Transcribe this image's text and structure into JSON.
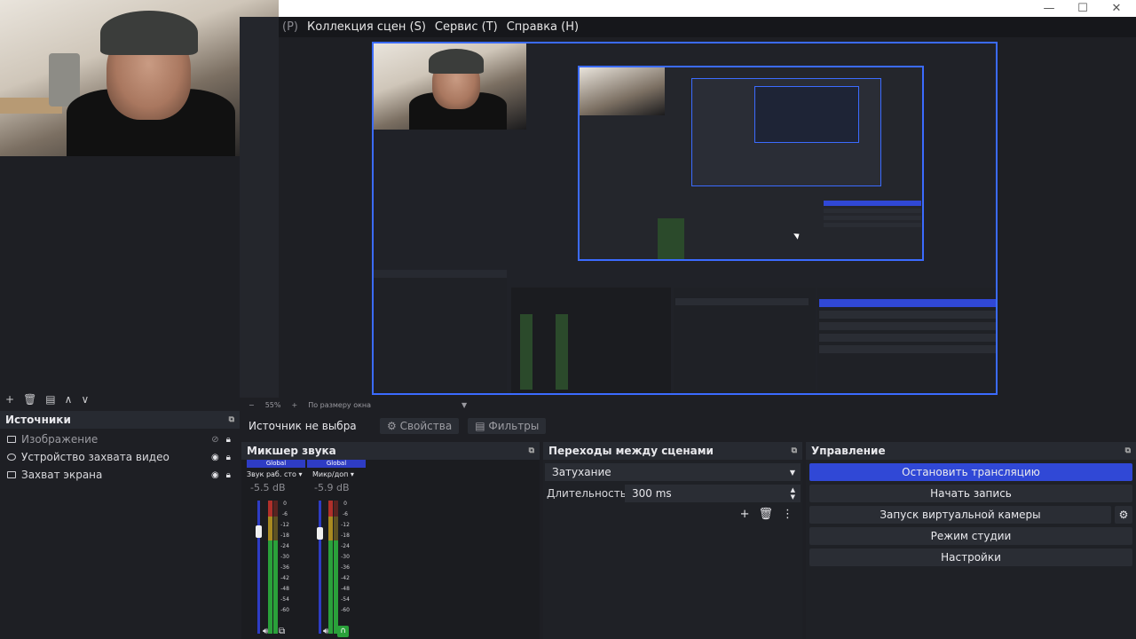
{
  "menu": {
    "prefix": "(P)",
    "items": [
      "Коллекция сцен (S)",
      "Сервис (T)",
      "Справка (H)"
    ]
  },
  "window_controls": {
    "minimize": "—",
    "maximize": "☐",
    "close": "✕"
  },
  "scene_toolbar": {
    "add": "+",
    "remove": "🗑",
    "filter": "▤",
    "up": "∧",
    "down": "∨"
  },
  "zoom": {
    "minus": "−",
    "level": "55%",
    "plus": "+",
    "mode": "По размеру окна"
  },
  "properties_bar": {
    "status": "Источник не выбра",
    "properties_label": "Свойства",
    "filters_label": "Фильтры"
  },
  "sources": {
    "title": "Источники",
    "items": [
      {
        "label": "Изображение",
        "visible": false,
        "locked": true
      },
      {
        "label": "Устройство захвата видео",
        "visible": true,
        "locked": true
      },
      {
        "label": "Захват экрана",
        "visible": true,
        "locked": true
      }
    ]
  },
  "mixer": {
    "title": "Микшер звука",
    "channels": [
      {
        "tag": "Global",
        "name": "Звук раб. сто",
        "db": "-5.5 dB",
        "level": 0.72
      },
      {
        "tag": "Global",
        "name": "Микр/доп",
        "db": "-5.9 dB",
        "level": 0.7
      }
    ],
    "scale": [
      "0",
      "-6",
      "-12",
      "-18",
      "-24",
      "-30",
      "-36",
      "-42",
      "-48",
      "-54",
      "-60"
    ]
  },
  "transitions": {
    "title": "Переходы между сценами",
    "selected": "Затухание",
    "duration_label": "Длительность",
    "duration_value": "300 ms"
  },
  "controls": {
    "title": "Управление",
    "stop_stream": "Остановить трансляцию",
    "start_record": "Начать запись",
    "virtual_cam": "Запуск виртуальной камеры",
    "studio_mode": "Режим студии",
    "settings": "Настройки"
  },
  "colors": {
    "accent": "#3048d6",
    "preview_border": "#3b6bff",
    "bg": "#1e1f24"
  }
}
